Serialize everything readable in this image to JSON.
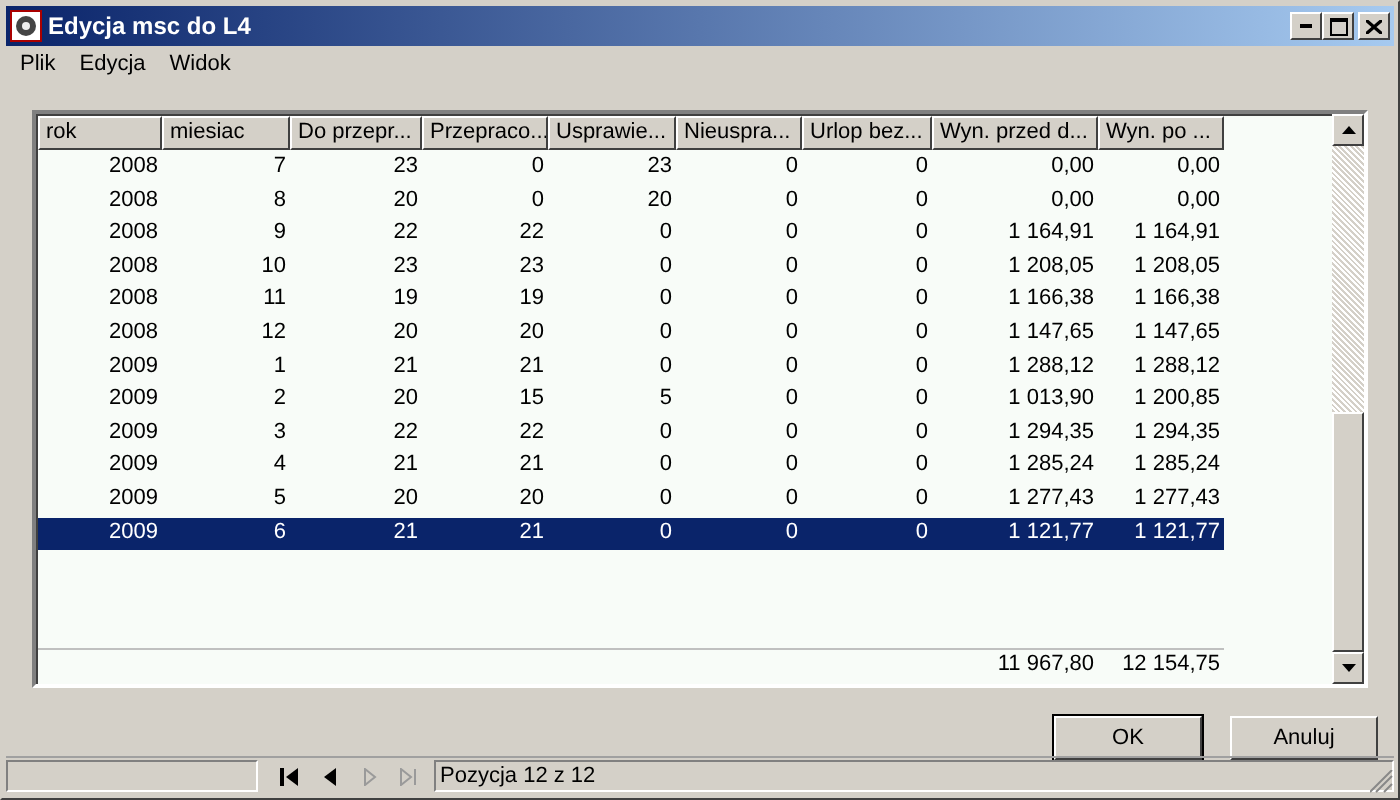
{
  "window": {
    "title": "Edycja msc do L4"
  },
  "menu": [
    "Plik",
    "Edycja",
    "Widok"
  ],
  "table": {
    "columns": [
      "rok",
      "miesiac",
      "Do przepr...",
      "Przepraco...",
      "Usprawie...",
      "Nieuspra...",
      "Urlop bez...",
      "Wyn. przed d...",
      "Wyn. po ..."
    ],
    "rows": [
      {
        "selected": false,
        "cells": [
          "2008",
          "7",
          "23",
          "0",
          "23",
          "0",
          "0",
          "0,00",
          "0,00"
        ]
      },
      {
        "selected": false,
        "cells": [
          "2008",
          "8",
          "20",
          "0",
          "20",
          "0",
          "0",
          "0,00",
          "0,00"
        ]
      },
      {
        "selected": false,
        "cells": [
          "2008",
          "9",
          "22",
          "22",
          "0",
          "0",
          "0",
          "1 164,91",
          "1 164,91"
        ]
      },
      {
        "selected": false,
        "cells": [
          "2008",
          "10",
          "23",
          "23",
          "0",
          "0",
          "0",
          "1 208,05",
          "1 208,05"
        ]
      },
      {
        "selected": false,
        "cells": [
          "2008",
          "11",
          "19",
          "19",
          "0",
          "0",
          "0",
          "1 166,38",
          "1 166,38"
        ]
      },
      {
        "selected": false,
        "cells": [
          "2008",
          "12",
          "20",
          "20",
          "0",
          "0",
          "0",
          "1 147,65",
          "1 147,65"
        ]
      },
      {
        "selected": false,
        "cells": [
          "2009",
          "1",
          "21",
          "21",
          "0",
          "0",
          "0",
          "1 288,12",
          "1 288,12"
        ]
      },
      {
        "selected": false,
        "cells": [
          "2009",
          "2",
          "20",
          "15",
          "5",
          "0",
          "0",
          "1 013,90",
          "1 200,85"
        ]
      },
      {
        "selected": false,
        "cells": [
          "2009",
          "3",
          "22",
          "22",
          "0",
          "0",
          "0",
          "1 294,35",
          "1 294,35"
        ]
      },
      {
        "selected": false,
        "cells": [
          "2009",
          "4",
          "21",
          "21",
          "0",
          "0",
          "0",
          "1 285,24",
          "1 285,24"
        ]
      },
      {
        "selected": false,
        "cells": [
          "2009",
          "5",
          "20",
          "20",
          "0",
          "0",
          "0",
          "1 277,43",
          "1 277,43"
        ]
      },
      {
        "selected": true,
        "cells": [
          "2009",
          "6",
          "21",
          "21",
          "0",
          "0",
          "0",
          "1 121,77",
          "1 121,77"
        ]
      }
    ],
    "totals": {
      "wyn_przed": "11 967,80",
      "wyn_po": "12 154,75"
    }
  },
  "buttons": [
    "OK",
    "Anuluj"
  ],
  "status_bar": {
    "navigation": [
      {
        "kind": "first",
        "disabled": false
      },
      {
        "kind": "prev",
        "disabled": false
      },
      {
        "kind": "next",
        "disabled": true
      },
      {
        "kind": "last",
        "disabled": true
      }
    ],
    "position": "Pozycja 12 z 12"
  }
}
